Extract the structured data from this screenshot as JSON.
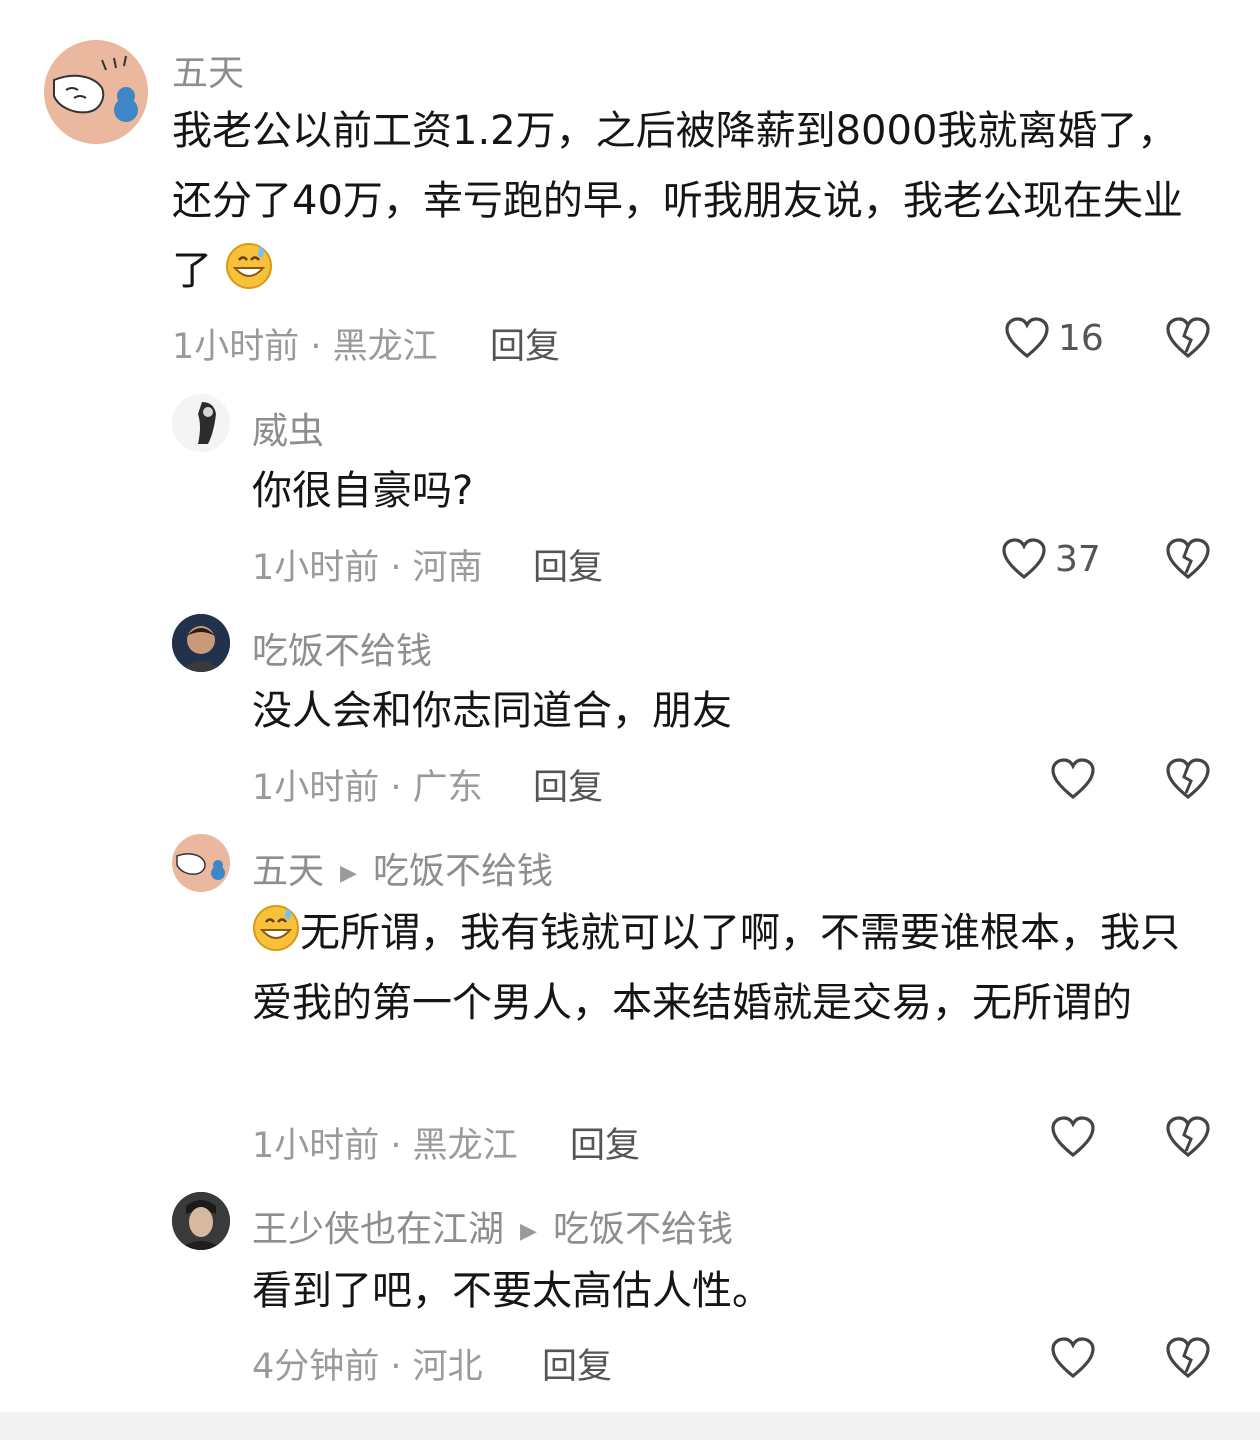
{
  "comments": [
    {
      "author": "五天",
      "text_before": "我老公以前工资1.2万，之后被降薪到8000我就离婚了，还分了40万，幸亏跑的早，听我朋友说，我老公现在失业了",
      "time_location": "1小时前 · 黑龙江",
      "reply": "回复",
      "likes": "16"
    },
    {
      "author": "威虫",
      "text": "你很自豪吗?",
      "time_location": "1小时前 · 河南",
      "reply": "回复",
      "likes": "37"
    },
    {
      "author": "吃饭不给钱",
      "text": "没人会和你志同道合，朋友",
      "time_location": "1小时前 · 广东",
      "reply": "回复"
    },
    {
      "author": "五天",
      "reply_to": "吃饭不给钱",
      "text": "无所谓，我有钱就可以了啊，不需要谁根本，我只爱我的第一个男人，本来结婚就是交易，无所谓的",
      "time_location": "1小时前 · 黑龙江",
      "reply": "回复"
    },
    {
      "author": "王少侠也在江湖",
      "reply_to": "吃饭不给钱",
      "text": "看到了吧，不要太高估人性。",
      "time_location": "4分钟前 · 河北",
      "reply": "回复"
    }
  ],
  "icons": {
    "like": "heart-icon",
    "dislike": "broken-heart-icon",
    "emoji": "grinning-sweat-emoji",
    "reply_arrow": "triangle-right-icon"
  },
  "colors": {
    "text": "#151515",
    "meta": "#9a9a9a",
    "icon": "#444444"
  }
}
